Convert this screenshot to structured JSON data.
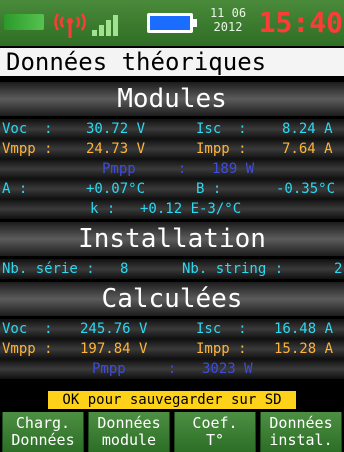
{
  "status": {
    "date_day_month": "11 06",
    "date_year": "2012",
    "time": "15:40",
    "icons": [
      "left-bar-icon",
      "antenna-icon",
      "signal-bars-icon",
      "battery-icon"
    ]
  },
  "title": "Données théoriques",
  "modules": {
    "header": "Modules",
    "voc_label": "Voc  :",
    "voc_value": "30.72 V",
    "isc_label": "Isc  :",
    "isc_value": "8.24 A",
    "vmpp_label": "Vmpp :",
    "vmpp_value": "24.73 V",
    "impp_label": "Impp :",
    "impp_value": "7.64 A",
    "pmpp_label": "Pmpp     :",
    "pmpp_value": "189 W",
    "a_label": "A :",
    "a_value": "+0.07°C",
    "b_label": "B :",
    "b_value": "-0.35°C",
    "k_label": "k :",
    "k_value": "+0.12 E-3/°C"
  },
  "installation": {
    "header": "Installation",
    "nb_serie_label": "Nb. série :",
    "nb_serie_value": "8",
    "nb_string_label": "Nb. string :",
    "nb_string_value": "2"
  },
  "calculees": {
    "header": "Calculées",
    "voc_label": "Voc  :",
    "voc_value": "245.76 V",
    "isc_label": "Isc  :",
    "isc_value": "16.48 A",
    "vmpp_label": "Vmpp :",
    "vmpp_value": "197.84 V",
    "impp_label": "Impp :",
    "impp_value": "15.28 A",
    "pmpp_label": "Pmpp     :",
    "pmpp_value": "3023 W"
  },
  "ok_message": "OK pour sauvegarder sur SD",
  "buttons": [
    {
      "line1": "Charg.",
      "line2": "Données"
    },
    {
      "line1": "Données",
      "line2": "module"
    },
    {
      "line1": "Coef.",
      "line2": "T°"
    },
    {
      "line1": "Données",
      "line2": "instal."
    }
  ],
  "colors": {
    "cyan": "#2bd9f2",
    "orange": "#ffb43a",
    "blue": "#3f4de0",
    "time_red": "#ff3b35",
    "button_green": "#3f8034",
    "ok_banner": "#ffd21a"
  }
}
